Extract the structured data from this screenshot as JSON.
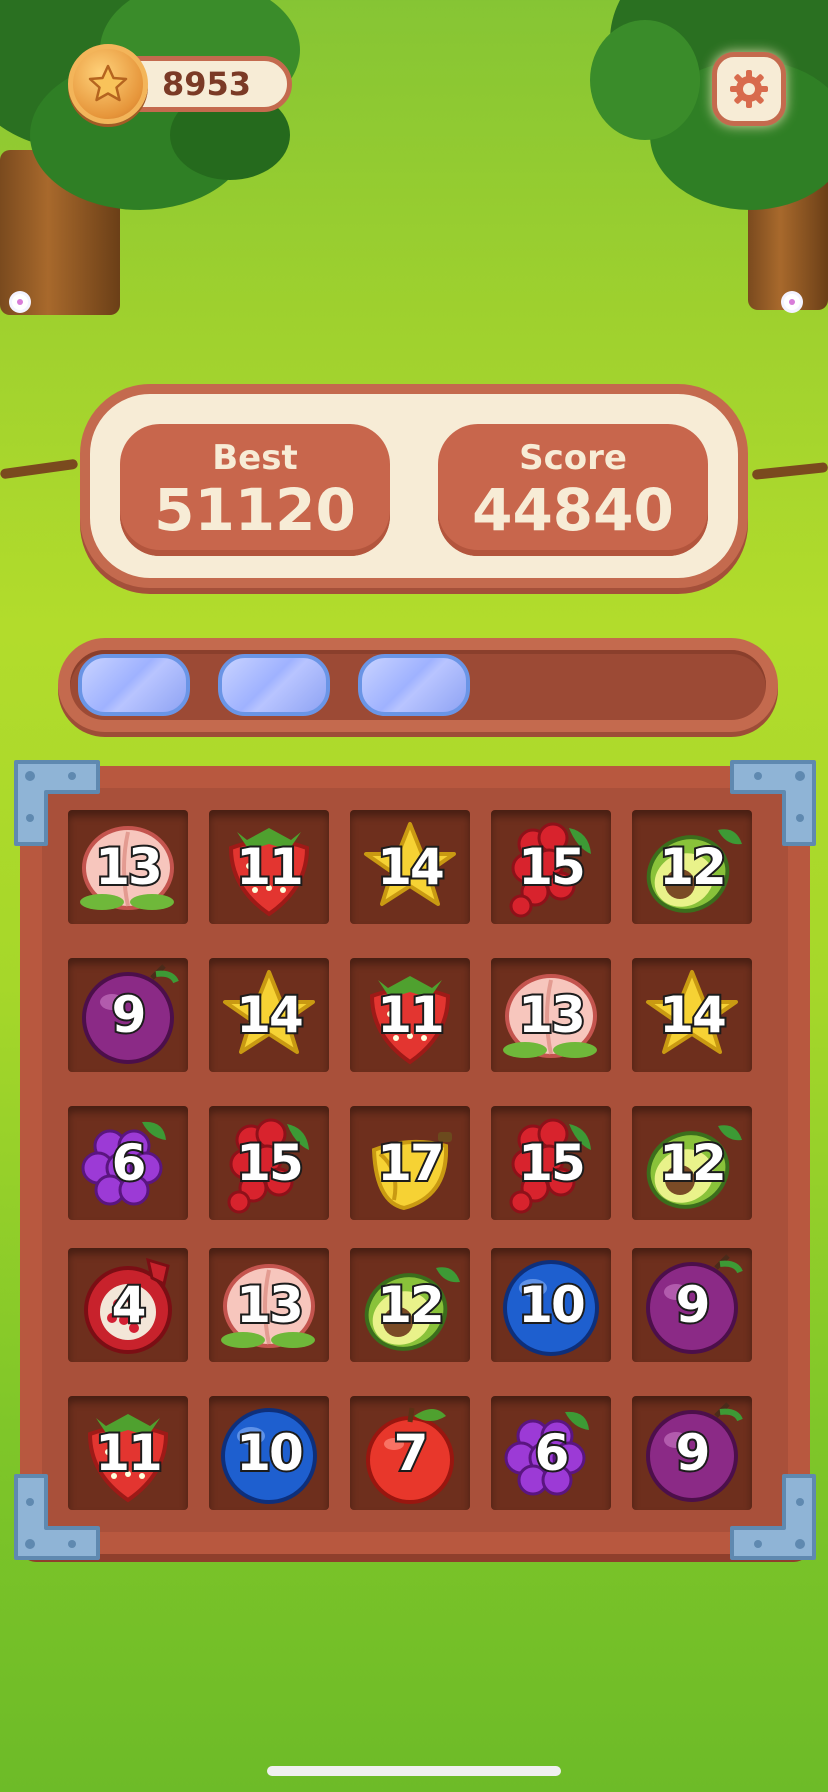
{
  "hud": {
    "coins": "8953",
    "coin_icon": "star-coin-icon",
    "settings_icon": "gear-icon"
  },
  "scores": {
    "best_label": "Best",
    "best_value": "51120",
    "score_label": "Score",
    "score_value": "44840"
  },
  "progress": {
    "filled_segments": 3,
    "total_segments": 5
  },
  "board": {
    "rows": 5,
    "cols": 5,
    "cells": [
      [
        {
          "fruit": "peach",
          "value": "13"
        },
        {
          "fruit": "strawberry",
          "value": "11"
        },
        {
          "fruit": "starfruit",
          "value": "14"
        },
        {
          "fruit": "redcurrant",
          "value": "15"
        },
        {
          "fruit": "avocado",
          "value": "12"
        }
      ],
      [
        {
          "fruit": "plum",
          "value": "9"
        },
        {
          "fruit": "starfruit",
          "value": "14"
        },
        {
          "fruit": "strawberry",
          "value": "11"
        },
        {
          "fruit": "peach",
          "value": "13"
        },
        {
          "fruit": "starfruit",
          "value": "14"
        }
      ],
      [
        {
          "fruit": "grape",
          "value": "6"
        },
        {
          "fruit": "redcurrant",
          "value": "15"
        },
        {
          "fruit": "banana",
          "value": "17"
        },
        {
          "fruit": "redcurrant",
          "value": "15"
        },
        {
          "fruit": "avocado",
          "value": "12"
        }
      ],
      [
        {
          "fruit": "pomegranate",
          "value": "4"
        },
        {
          "fruit": "peach",
          "value": "13"
        },
        {
          "fruit": "avocado",
          "value": "12"
        },
        {
          "fruit": "blueberry",
          "value": "10"
        },
        {
          "fruit": "plum",
          "value": "9"
        }
      ],
      [
        {
          "fruit": "strawberry",
          "value": "11"
        },
        {
          "fruit": "blueberry",
          "value": "10"
        },
        {
          "fruit": "apple",
          "value": "7"
        },
        {
          "fruit": "grape",
          "value": "6"
        },
        {
          "fruit": "plum",
          "value": "9"
        }
      ]
    ]
  }
}
